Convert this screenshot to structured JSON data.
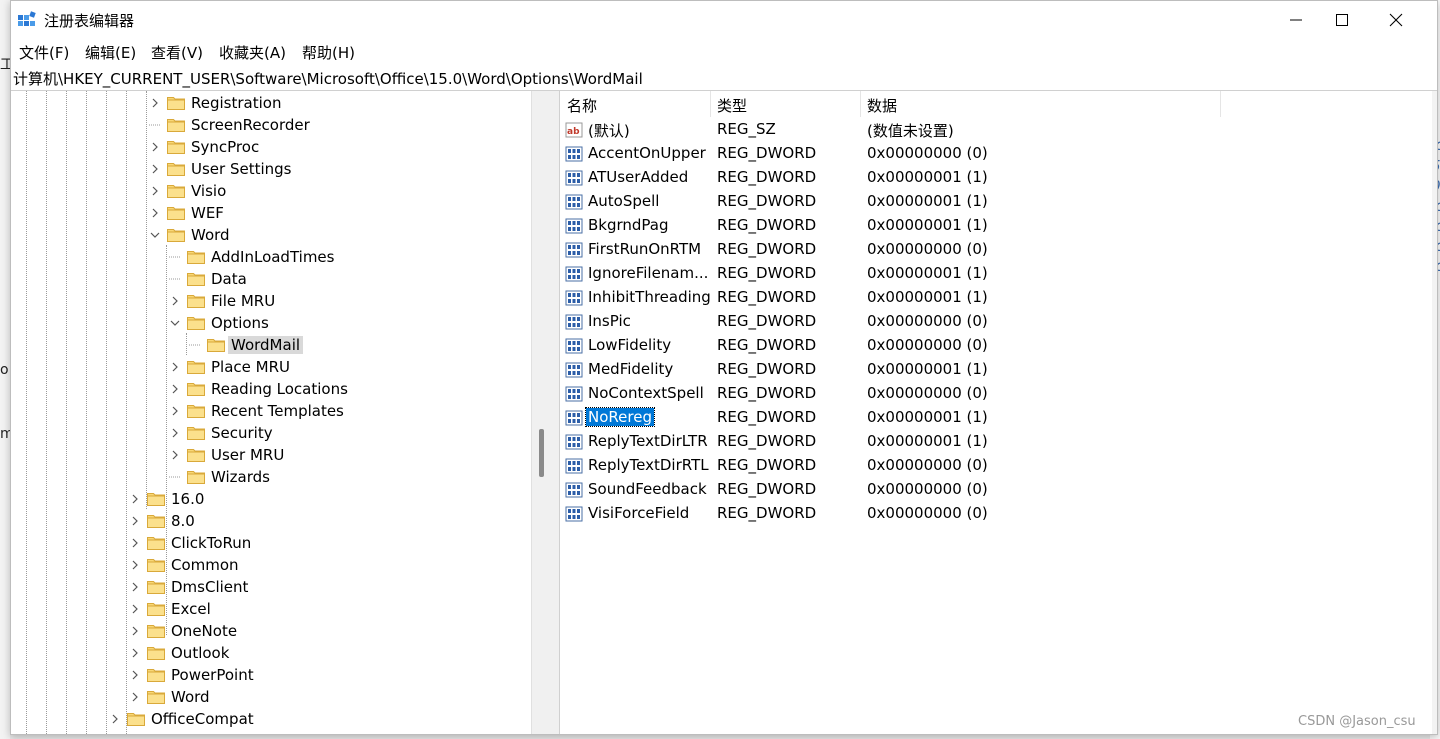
{
  "window": {
    "title": "注册表编辑器"
  },
  "menu": [
    {
      "label": "文件(F)"
    },
    {
      "label": "编辑(E)"
    },
    {
      "label": "查看(V)"
    },
    {
      "label": "收藏夹(A)"
    },
    {
      "label": "帮助(H)"
    }
  ],
  "address": {
    "path": "计算机\\HKEY_CURRENT_USER\\Software\\Microsoft\\Office\\15.0\\Word\\Options\\WordMail"
  },
  "tree": [
    {
      "label": "Registration",
      "level": 2,
      "expander": "collapsed"
    },
    {
      "label": "ScreenRecorder",
      "level": 2,
      "expander": "none"
    },
    {
      "label": "SyncProc",
      "level": 2,
      "expander": "collapsed"
    },
    {
      "label": "User Settings",
      "level": 2,
      "expander": "collapsed"
    },
    {
      "label": "Visio",
      "level": 2,
      "expander": "collapsed"
    },
    {
      "label": "WEF",
      "level": 2,
      "expander": "collapsed"
    },
    {
      "label": "Word",
      "level": 2,
      "expander": "expanded"
    },
    {
      "label": "AddInLoadTimes",
      "level": 3,
      "expander": "none"
    },
    {
      "label": "Data",
      "level": 3,
      "expander": "none"
    },
    {
      "label": "File MRU",
      "level": 3,
      "expander": "collapsed"
    },
    {
      "label": "Options",
      "level": 3,
      "expander": "expanded"
    },
    {
      "label": "WordMail",
      "level": 4,
      "expander": "none",
      "selected": true
    },
    {
      "label": "Place MRU",
      "level": 3,
      "expander": "collapsed"
    },
    {
      "label": "Reading Locations",
      "level": 3,
      "expander": "collapsed"
    },
    {
      "label": "Recent Templates",
      "level": 3,
      "expander": "collapsed"
    },
    {
      "label": "Security",
      "level": 3,
      "expander": "collapsed"
    },
    {
      "label": "User MRU",
      "level": 3,
      "expander": "collapsed"
    },
    {
      "label": "Wizards",
      "level": 3,
      "expander": "none"
    },
    {
      "label": "16.0",
      "level": 1,
      "expander": "collapsed"
    },
    {
      "label": "8.0",
      "level": 1,
      "expander": "collapsed"
    },
    {
      "label": "ClickToRun",
      "level": 1,
      "expander": "collapsed"
    },
    {
      "label": "Common",
      "level": 1,
      "expander": "collapsed"
    },
    {
      "label": "DmsClient",
      "level": 1,
      "expander": "collapsed"
    },
    {
      "label": "Excel",
      "level": 1,
      "expander": "collapsed"
    },
    {
      "label": "OneNote",
      "level": 1,
      "expander": "collapsed"
    },
    {
      "label": "Outlook",
      "level": 1,
      "expander": "collapsed"
    },
    {
      "label": "PowerPoint",
      "level": 1,
      "expander": "collapsed"
    },
    {
      "label": "Word",
      "level": 1,
      "expander": "collapsed"
    },
    {
      "label": "OfficeCompat",
      "level": 0,
      "expander": "collapsed"
    }
  ],
  "list": {
    "headers": {
      "name": "名称",
      "type": "类型",
      "data": "数据"
    },
    "rows": [
      {
        "name": "(默认)",
        "type": "REG_SZ",
        "data": "(数值未设置)",
        "icon": "string-value-icon"
      },
      {
        "name": "AccentOnUpper",
        "type": "REG_DWORD",
        "data": "0x00000000 (0)",
        "icon": "dword-value-icon"
      },
      {
        "name": "ATUserAdded",
        "type": "REG_DWORD",
        "data": "0x00000001 (1)",
        "icon": "dword-value-icon"
      },
      {
        "name": "AutoSpell",
        "type": "REG_DWORD",
        "data": "0x00000001 (1)",
        "icon": "dword-value-icon"
      },
      {
        "name": "BkgrndPag",
        "type": "REG_DWORD",
        "data": "0x00000001 (1)",
        "icon": "dword-value-icon"
      },
      {
        "name": "FirstRunOnRTM",
        "type": "REG_DWORD",
        "data": "0x00000000 (0)",
        "icon": "dword-value-icon"
      },
      {
        "name": "IgnoreFilenam...",
        "type": "REG_DWORD",
        "data": "0x00000001 (1)",
        "icon": "dword-value-icon"
      },
      {
        "name": "InhibitThreading",
        "type": "REG_DWORD",
        "data": "0x00000001 (1)",
        "icon": "dword-value-icon"
      },
      {
        "name": "InsPic",
        "type": "REG_DWORD",
        "data": "0x00000000 (0)",
        "icon": "dword-value-icon"
      },
      {
        "name": "LowFidelity",
        "type": "REG_DWORD",
        "data": "0x00000000 (0)",
        "icon": "dword-value-icon"
      },
      {
        "name": "MedFidelity",
        "type": "REG_DWORD",
        "data": "0x00000001 (1)",
        "icon": "dword-value-icon"
      },
      {
        "name": "NoContextSpell",
        "type": "REG_DWORD",
        "data": "0x00000000 (0)",
        "icon": "dword-value-icon"
      },
      {
        "name": "NoRereg",
        "type": "REG_DWORD",
        "data": "0x00000001 (1)",
        "icon": "dword-value-icon",
        "selected": true
      },
      {
        "name": "ReplyTextDirLTR",
        "type": "REG_DWORD",
        "data": "0x00000001 (1)",
        "icon": "dword-value-icon"
      },
      {
        "name": "ReplyTextDirRTL",
        "type": "REG_DWORD",
        "data": "0x00000000 (0)",
        "icon": "dword-value-icon"
      },
      {
        "name": "SoundFeedback",
        "type": "REG_DWORD",
        "data": "0x00000000 (0)",
        "icon": "dword-value-icon"
      },
      {
        "name": "VisiForceField",
        "type": "REG_DWORD",
        "data": "0x00000000 (0)",
        "icon": "dword-value-icon"
      }
    ]
  },
  "background": {
    "left_fragments": [
      "工",
      "o",
      "m"
    ],
    "right_fragments": [
      "lc",
      "50",
      "00",
      "lc",
      "lc",
      "lc",
      "lc"
    ]
  },
  "watermark": "CSDN @Jason_csu",
  "colors": {
    "selection": "#0078d7",
    "folder": "#f8d775",
    "tree_selection": "#d9d9d9"
  }
}
